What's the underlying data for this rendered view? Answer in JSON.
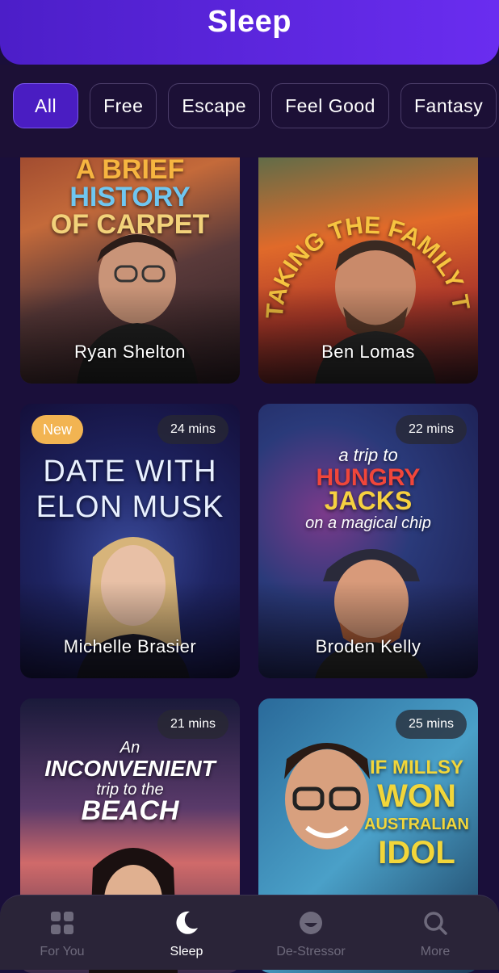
{
  "header": {
    "title": "Sleep"
  },
  "filters": [
    "All",
    "Free",
    "Escape",
    "Feel Good",
    "Fantasy"
  ],
  "active_filter": "All",
  "cards": [
    {
      "art_title": [
        "A BRIEF",
        "HISTORY",
        "OF CARPET"
      ],
      "name": "Ryan Shelton",
      "badge": "",
      "duration": ""
    },
    {
      "art_title": [
        "TAKING THE FAMILY TO THAILAND"
      ],
      "name": "Ben Lomas",
      "badge": "",
      "duration": ""
    },
    {
      "art_title": [
        "DATE WITH",
        "ELON MUSK"
      ],
      "name": "Michelle Brasier",
      "badge": "New",
      "duration": "24 mins"
    },
    {
      "art_title": [
        "a trip to",
        "HUNGRY",
        "JACKS",
        "on a magical chip"
      ],
      "name": "Broden Kelly",
      "badge": "",
      "duration": "22 mins"
    },
    {
      "art_title": [
        "An",
        "INCONVENIENT",
        "trip to the",
        "BEACH"
      ],
      "name": "",
      "badge": "",
      "duration": "21 mins"
    },
    {
      "art_title": [
        "IF MILLSY",
        "WON",
        "AUSTRALIAN",
        "IDOL"
      ],
      "name": "",
      "badge": "",
      "duration": "25 mins"
    }
  ],
  "tabbar": [
    {
      "label": "For You",
      "icon": "grid-icon",
      "active": false
    },
    {
      "label": "Sleep",
      "icon": "moon-icon",
      "active": true
    },
    {
      "label": "De-Stressor",
      "icon": "smile-icon",
      "active": false
    },
    {
      "label": "More",
      "icon": "search-icon",
      "active": false
    }
  ],
  "colors": {
    "header": "#5a26e0",
    "active_chip": "#4a1dc2",
    "new_badge": "#f2b452",
    "background": "#1a0f3a"
  }
}
